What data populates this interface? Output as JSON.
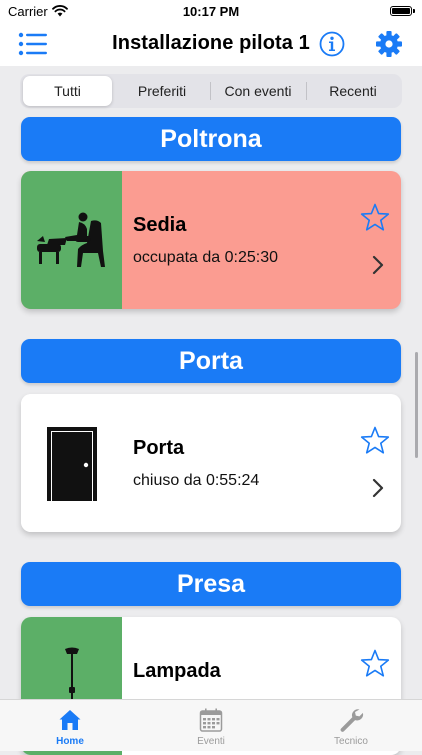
{
  "status_bar": {
    "carrier": "Carrier",
    "time": "10:17 PM"
  },
  "nav": {
    "title": "Installazione pilota 1",
    "menu_icon": "list-icon",
    "info_icon": "info-icon",
    "settings_icon": "gear-icon"
  },
  "segments": [
    {
      "label": "Tutti",
      "selected": true
    },
    {
      "label": "Preferiti",
      "selected": false
    },
    {
      "label": "Con eventi",
      "selected": false
    },
    {
      "label": "Recenti",
      "selected": false
    }
  ],
  "sections": [
    {
      "title": "Poltrona",
      "device": {
        "name": "Sedia",
        "state": "occupata da 0:25:30",
        "icon": "armchair-icon",
        "icon_bg": "#5caf67",
        "card_bg": "#fb9c91",
        "favorite": false
      }
    },
    {
      "title": "Porta",
      "device": {
        "name": "Porta",
        "state": "chiuso da 0:55:24",
        "icon": "door-icon",
        "icon_bg": "#ffffff",
        "card_bg": "#ffffff",
        "favorite": false
      }
    },
    {
      "title": "Presa",
      "device": {
        "name": "Lampada",
        "state": "",
        "icon": "floor-lamp-icon",
        "icon_bg": "#5caf67",
        "card_bg": "#ffffff",
        "favorite": false
      }
    }
  ],
  "tabs": [
    {
      "label": "Home",
      "icon": "house-icon",
      "active": true
    },
    {
      "label": "Eventi",
      "icon": "calendar-icon",
      "active": false
    },
    {
      "label": "Tecnico",
      "icon": "wrench-icon",
      "active": false
    }
  ],
  "colors": {
    "accent": "#1a7bf6",
    "tab_inactive": "#9b9b9b"
  }
}
